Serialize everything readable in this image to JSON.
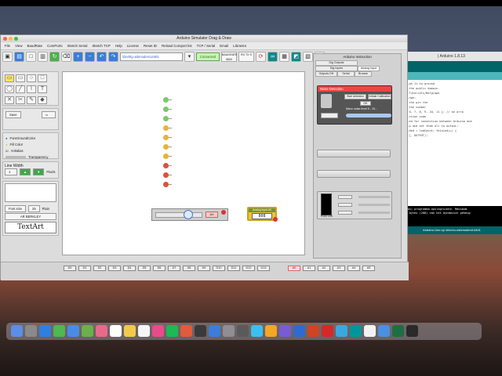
{
  "window": {
    "title": "Arduino Simulator Drag & Draw"
  },
  "menu": [
    "File",
    "View",
    "BaudRate",
    "ComPorts",
    "Sketch Serial",
    "Sketch TCP",
    "Help",
    "License",
    "Reset ID",
    "Reload Comport list",
    "TCP / Serial",
    "Email",
    "Libraries"
  ],
  "toolbar": {
    "port": "/dev/tty.usbmodem14401",
    "connected": "Connected",
    "baud_label": "BAUDRATE",
    "baud_value": "9600",
    "rx_tx": "RX  TX  S"
  },
  "palette": {
    "foreground": "ForeGroundColor",
    "fill": "Fill Color",
    "antialias": "Antialias",
    "transparency": "Transparency",
    "line_width_label": "Line Width",
    "line_width_value": "1",
    "pixels": "Pixels",
    "font_name": "Font size",
    "font_size": "25",
    "plain": "Plain",
    "face": "AR BERKLEY",
    "textart": "TextArt",
    "save": "Save",
    "reset_io": "Reset I/O"
  },
  "instruction": {
    "title": "Arduino Instruction",
    "tabs": [
      "Dig Outputs",
      "Dig Inputs",
      "Analog Input",
      "Outputs DH",
      "Serial",
      "Browse"
    ],
    "noise_title": "Noise Detection",
    "start_btn": "Start detection",
    "calibrate_btn": "Initiate Calibration",
    "ok": "OK",
    "noise_label": "Micro noise level 5 - 10...",
    "rgb_label": "RGB Led"
  },
  "canvas": {
    "slider_value": "A0",
    "analog_title": "Analog Input A0",
    "analog_value": "808"
  },
  "pins": {
    "digital": [
      "D0",
      "D1",
      "D2",
      "D3",
      "D4",
      "D5",
      "D6",
      "D7",
      "D8",
      "D9",
      "D10",
      "D11",
      "D12",
      "D13"
    ],
    "analog": [
      "A0",
      "A1",
      "A2",
      "A3",
      "A4",
      "A5"
    ]
  },
  "ide": {
    "title": "| Arduino 1.8.13",
    "code": [
      "...gh 11 to ground",
      "",
      "...the public domain.",
      "",
      "...Tutorials/Bargraph",
      "",
      "...nge:",
      "                // the pin the",
      "                // the number",
      "5, 6, 7, 8, 9, 10, 11 }; // an arra",
      "",
      "...ction code",
      "",
      "...ed for connection between Arduino and",
      "",
      "...p and set them all to output:",
      "...ded = ledCount; thisLed++) {",
      "...], OUTPUT);"
    ],
    "console": [
      "...ks) programma-opslagruimte. Maximum",
      "... bytes (208) van het dynamisch geheug"
    ],
    "status": "Arduino Uno op /dev/cu.usbmodem14401"
  },
  "colors": {
    "connected_bg": "#c9f2b8",
    "module_red": "#ee4444",
    "analog_bg": "#e8c53a",
    "ide_teal": "#006468"
  }
}
